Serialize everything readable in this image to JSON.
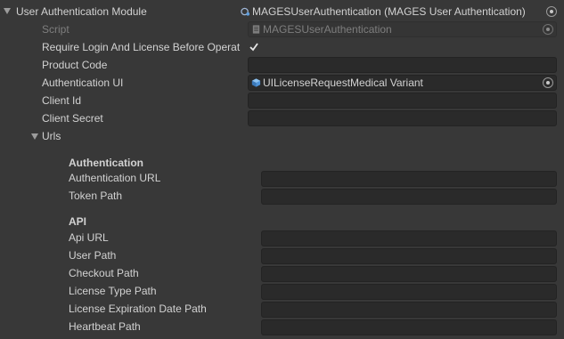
{
  "header": {
    "title": "User Authentication Module",
    "value": "MAGESUserAuthentication (MAGES User Authentication)",
    "icon": "component-icon"
  },
  "fields": {
    "script": {
      "label": "Script",
      "value": "MAGESUserAuthentication",
      "icon": "script-icon"
    },
    "require_login": {
      "label": "Require Login And License Before Operat",
      "checked": true
    },
    "product_code": {
      "label": "Product Code",
      "value": ""
    },
    "authentication_ui": {
      "label": "Authentication UI",
      "value": "UILicenseRequestMedical Variant",
      "icon": "prefab-icon"
    },
    "client_id": {
      "label": "Client Id",
      "value": ""
    },
    "client_secret": {
      "label": "Client Secret",
      "value": ""
    }
  },
  "urls": {
    "label": "Urls",
    "authentication_header": "Authentication",
    "authentication_url": {
      "label": "Authentication URL",
      "value": ""
    },
    "token_path": {
      "label": "Token Path",
      "value": ""
    },
    "api_header": "API",
    "api_url": {
      "label": "Api URL",
      "value": ""
    },
    "user_path": {
      "label": "User Path",
      "value": ""
    },
    "checkout_path": {
      "label": "Checkout Path",
      "value": ""
    },
    "license_type_path": {
      "label": "License Type Path",
      "value": ""
    },
    "license_expiration_date_path": {
      "label": "License Expiration Date Path",
      "value": ""
    },
    "heartbeat_path": {
      "label": "Heartbeat Path",
      "value": ""
    }
  },
  "colors": {
    "background": "#383838",
    "field_bg": "#2a2a2a",
    "text": "#d2d2d2",
    "disabled_text": "#7e7e7e"
  }
}
